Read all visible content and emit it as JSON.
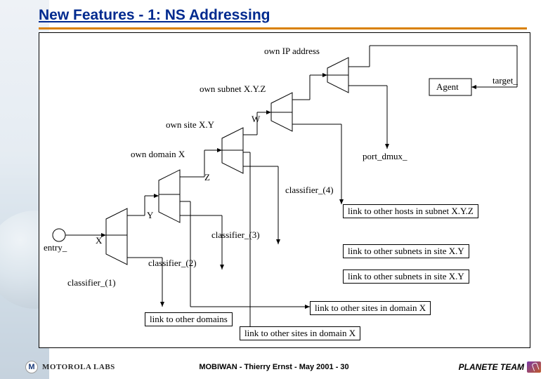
{
  "title": "New Features - 1: NS Addressing",
  "diagram": {
    "top_labels": {
      "own_ip": "own IP address",
      "own_subnet": "own subnet X.Y.Z",
      "own_site": "own site X.Y",
      "own_domain": "own domain X",
      "entry": "entry_",
      "target": "target_",
      "agent": "Agent",
      "port_dmux": "port_dmux_"
    },
    "stage_labels": {
      "x": "X",
      "y": "Y",
      "z": "Z",
      "w": "W"
    },
    "classifiers": {
      "c1": "classifier_(1)",
      "c2": "classifier_(2)",
      "c3": "classifier_(3)",
      "c4": "classifier_(4)"
    },
    "link_boxes": {
      "hosts_in_subnet": "link to other hosts in subnet X.Y.Z",
      "subnets_in_site_1": "link to other subnets in site X.Y",
      "subnets_in_site_2": "link to other subnets in site X.Y",
      "sites_in_domain_1": "link to other sites in domain X",
      "sites_in_domain_2": "link to other sites in domain X",
      "other_domains": "link to other domains"
    }
  },
  "footer": {
    "labs": "MOTOROLA LABS",
    "center": "MOBIWAN - Thierry Ernst - May 2001 - 30",
    "right": "PLANETE TEAM"
  }
}
